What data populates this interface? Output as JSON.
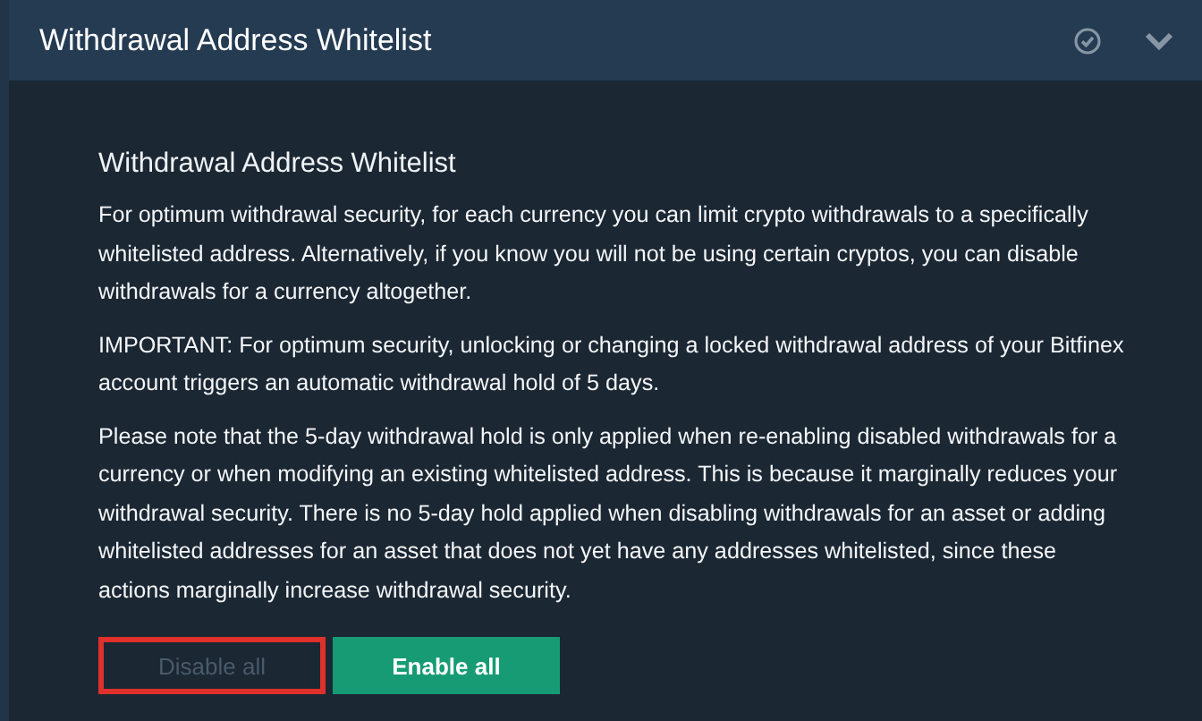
{
  "header": {
    "title": "Withdrawal Address Whitelist",
    "verified": true,
    "expanded": true
  },
  "section": {
    "title": "Withdrawal Address Whitelist",
    "paragraphs": [
      "For optimum withdrawal security, for each currency you can limit crypto withdrawals to a specifically whitelisted address. Alternatively, if you know you will not be using certain cryptos, you can disable withdrawals for a currency altogether.",
      "IMPORTANT: For optimum security, unlocking or changing a locked withdrawal address of your Bitfinex account triggers an automatic withdrawal hold of 5 days.",
      "Please note that the 5-day withdrawal hold is only applied when re-enabling disabled withdrawals for a currency or when modifying an existing whitelisted address. This is because it marginally reduces your withdrawal security. There is no 5-day hold applied when disabling withdrawals for an asset or adding whitelisted addresses for an asset that does not yet have any addresses whitelisted, since these actions marginally increase withdrawal security."
    ]
  },
  "buttons": [
    {
      "label": "Disable all",
      "kind": "secondary",
      "disabled": true,
      "highlighted": true
    },
    {
      "label": "Enable all",
      "kind": "primary",
      "disabled": false,
      "highlighted": false
    }
  ]
}
